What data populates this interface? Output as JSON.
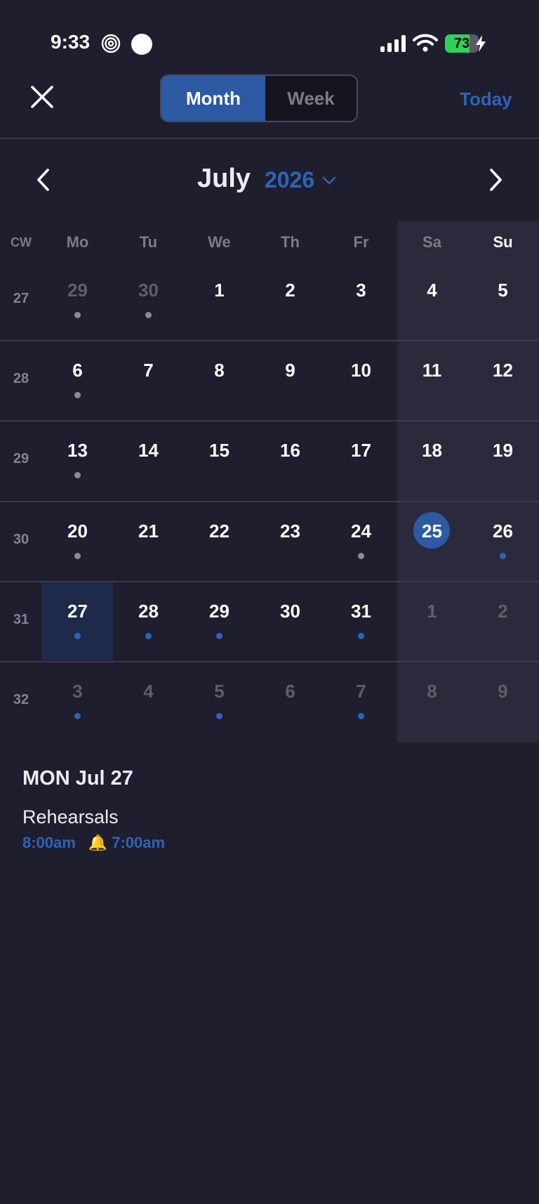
{
  "status": {
    "time": "9:33",
    "battery": "73",
    "battery_level": 0.73
  },
  "header": {
    "views": [
      {
        "label": "Month",
        "active": true
      },
      {
        "label": "Week",
        "active": false
      }
    ],
    "today_label": "Today"
  },
  "nav": {
    "month": "July",
    "year": "2026"
  },
  "weekdays": {
    "cw": "CW",
    "days": [
      "Mo",
      "Tu",
      "We",
      "Th",
      "Fr",
      "Sa",
      "Su"
    ]
  },
  "weeks": [
    {
      "cw": "27",
      "days": [
        {
          "n": "29",
          "muted": true,
          "dot": "gray"
        },
        {
          "n": "30",
          "muted": true,
          "dot": "gray"
        },
        {
          "n": "1"
        },
        {
          "n": "2"
        },
        {
          "n": "3"
        },
        {
          "n": "4"
        },
        {
          "n": "5"
        }
      ]
    },
    {
      "cw": "28",
      "days": [
        {
          "n": "6",
          "dot": "gray"
        },
        {
          "n": "7"
        },
        {
          "n": "8"
        },
        {
          "n": "9"
        },
        {
          "n": "10"
        },
        {
          "n": "11"
        },
        {
          "n": "12"
        }
      ]
    },
    {
      "cw": "29",
      "days": [
        {
          "n": "13",
          "dot": "gray"
        },
        {
          "n": "14"
        },
        {
          "n": "15"
        },
        {
          "n": "16"
        },
        {
          "n": "17"
        },
        {
          "n": "18"
        },
        {
          "n": "19"
        }
      ]
    },
    {
      "cw": "30",
      "days": [
        {
          "n": "20",
          "dot": "gray"
        },
        {
          "n": "21"
        },
        {
          "n": "22"
        },
        {
          "n": "23"
        },
        {
          "n": "24",
          "dot": "gray"
        },
        {
          "n": "25",
          "today": true
        },
        {
          "n": "26",
          "dot": "blue"
        }
      ]
    },
    {
      "cw": "31",
      "days": [
        {
          "n": "27",
          "dot": "blue",
          "selected": true
        },
        {
          "n": "28",
          "dot": "blue"
        },
        {
          "n": "29",
          "dot": "blue"
        },
        {
          "n": "30"
        },
        {
          "n": "31",
          "dot": "blue"
        },
        {
          "n": "1",
          "muted": true
        },
        {
          "n": "2",
          "muted": true
        }
      ]
    },
    {
      "cw": "32",
      "days": [
        {
          "n": "3",
          "muted": true,
          "dot": "blue"
        },
        {
          "n": "4",
          "muted": true
        },
        {
          "n": "5",
          "muted": true,
          "dot": "blue"
        },
        {
          "n": "6",
          "muted": true
        },
        {
          "n": "7",
          "muted": true,
          "dot": "blue"
        },
        {
          "n": "8",
          "muted": true
        },
        {
          "n": "9",
          "muted": true
        }
      ]
    }
  ],
  "agenda": {
    "date_label": "MON Jul 27",
    "events": [
      {
        "title": "Rehearsals",
        "time": "8:00am",
        "bell": "🔔",
        "alarm": "7:00am"
      }
    ]
  },
  "colors": {
    "background": "#1f1e2e",
    "accent": "#2e63b8",
    "accent_fill": "#2d5aa3",
    "weekend": "#2a2a3c",
    "battery_green": "#30d158"
  }
}
